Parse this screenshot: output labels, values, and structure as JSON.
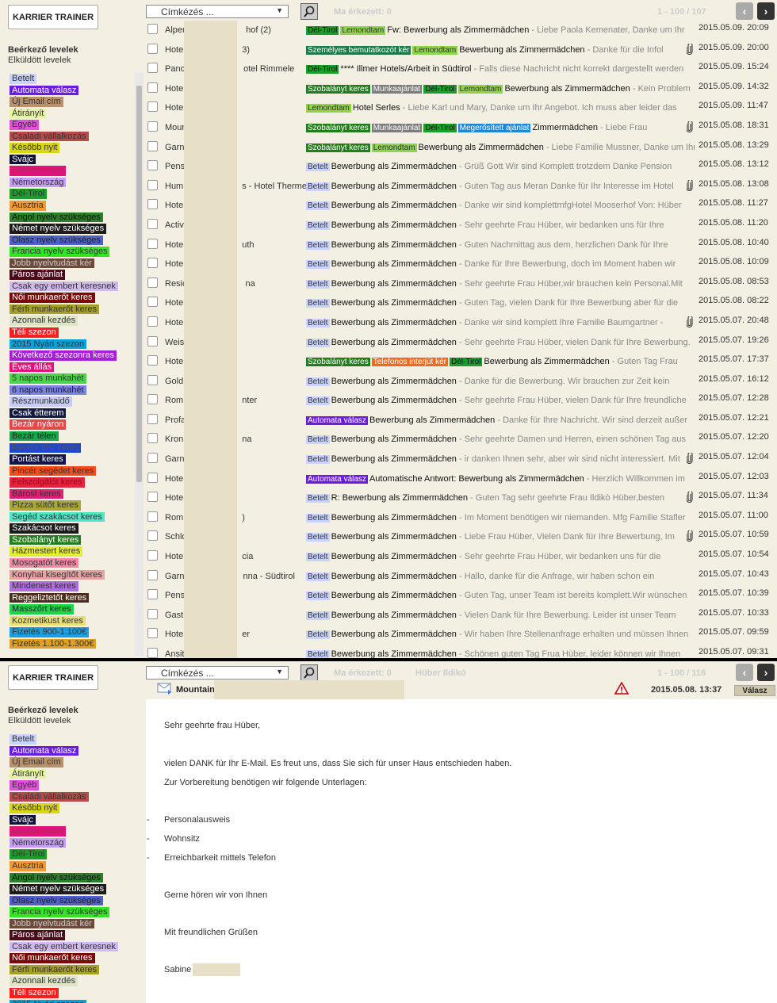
{
  "app": {
    "logo_label": "KARRIER TRAINER"
  },
  "sidebar": {
    "inbox_label": "Beérkező levelek",
    "sent_label": "Elküldött levelek",
    "labels": [
      {
        "text": "Betelt",
        "bg": "#c9d3ff",
        "fg": "#333"
      },
      {
        "text": "Automata válasz",
        "bg": "#6a1de0",
        "fg": "#fff"
      },
      {
        "text": "Új Email cím",
        "bg": "#b9916a",
        "fg": "#333"
      },
      {
        "text": "Átirányít",
        "bg": "#e6f3a3",
        "fg": "#333"
      },
      {
        "text": "Egyéb",
        "bg": "#e252d8",
        "fg": "#333"
      },
      {
        "text": "Családi vállalkozás",
        "bg": "#b64b4b",
        "fg": "#333"
      },
      {
        "text": "Később nyit",
        "bg": "#d9d614",
        "fg": "#333"
      },
      {
        "text": "Svájc",
        "bg": "#121236",
        "fg": "#fff"
      },
      {
        "text": "Liechtenstein",
        "bg": "#e0137a",
        "fg": "#b42a58"
      },
      {
        "text": "Németország",
        "bg": "#c79ef5",
        "fg": "#333"
      },
      {
        "text": "Dél-Tirol",
        "bg": "#1b9f2a",
        "fg": "#333"
      },
      {
        "text": "Ausztria",
        "bg": "#f29a34",
        "fg": "#333"
      },
      {
        "text": "Angol nyelv szükséges",
        "bg": "#2c7f2a",
        "fg": "#111"
      },
      {
        "text": "Német nyelv szükséges",
        "bg": "#1c1c1c",
        "fg": "#fff"
      },
      {
        "text": "Olasz nyelv szükséges",
        "bg": "#4f61c9",
        "fg": "#222"
      },
      {
        "text": "Francia nyelv szükséges",
        "bg": "#31e624",
        "fg": "#333"
      },
      {
        "text": "Jobb nyelvtudást kér",
        "bg": "#6b4a3a",
        "fg": "#ccc"
      },
      {
        "text": "Páros ajánlat",
        "bg": "#4a0b1a",
        "fg": "#fff"
      },
      {
        "text": "Csak egy embert keresnek",
        "bg": "#d0b9ee",
        "fg": "#333"
      },
      {
        "text": "Női munkaerőt keres",
        "bg": "#7a0a0a",
        "fg": "#fff"
      },
      {
        "text": "Férfi munkaerőt keres",
        "bg": "#a6a02a",
        "fg": "#333"
      },
      {
        "text": "Azonnali kezdés",
        "bg": "#dfe5c7",
        "fg": "#333"
      },
      {
        "text": "Téli szezon",
        "bg": "#f41f1f",
        "fg": "#fff"
      },
      {
        "text": "2015 Nyári szezon",
        "bg": "#0aa3d9",
        "fg": "#234"
      },
      {
        "text": "Következő szezonra keres",
        "bg": "#a61fd6",
        "fg": "#fff"
      },
      {
        "text": "Éves állás",
        "bg": "#e5117a",
        "fg": "#fff"
      },
      {
        "text": "5 napos munkahét",
        "bg": "#4fd34f",
        "fg": "#333"
      },
      {
        "text": "6 napos munkahét",
        "bg": "#7a82e2",
        "fg": "#222"
      },
      {
        "text": "Részmunkaidő",
        "bg": "#c7ccf4",
        "fg": "#333"
      },
      {
        "text": "Csak étterem",
        "bg": "#111b3d",
        "fg": "#fff"
      },
      {
        "text": "Bezár nyáron",
        "bg": "#e0494a",
        "fg": "#fff"
      },
      {
        "text": "Bezár télen",
        "bg": "#17a84a",
        "fg": "#222"
      },
      {
        "text": "Recepcióst keres",
        "bg": "#1e46d0",
        "fg": "#555"
      },
      {
        "text": "Portást keres",
        "bg": "#141449",
        "fg": "#fff"
      },
      {
        "text": "Pincér segédet keres",
        "bg": "#f74d1a",
        "fg": "#333"
      },
      {
        "text": "Felszolgálót keres",
        "bg": "#e0263d",
        "fg": "#a02"
      },
      {
        "text": "Bárost keres",
        "bg": "#e31f75",
        "fg": "#333"
      },
      {
        "text": "Pizza sütőt keres",
        "bg": "#a7a73a",
        "fg": "#333"
      },
      {
        "text": "Segéd szakácsot keres",
        "bg": "#4fe6c6",
        "fg": "#333"
      },
      {
        "text": "Szakácsot keres",
        "bg": "#1b1b1b",
        "fg": "#fff"
      },
      {
        "text": "Szobalányt keres",
        "bg": "#237d1d",
        "fg": "#fff"
      },
      {
        "text": "Házmestert keres",
        "bg": "#e3ee33",
        "fg": "#333"
      },
      {
        "text": "Mosogatót keres",
        "bg": "#f28aa7",
        "fg": "#333"
      },
      {
        "text": "Konyhai kisegítőt keres",
        "bg": "#e7a3a3",
        "fg": "#333"
      },
      {
        "text": "Mindenest keres",
        "bg": "#b06de0",
        "fg": "#333"
      },
      {
        "text": "Reggeliztetőt keres",
        "bg": "#4b2c1f",
        "fg": "#fff"
      },
      {
        "text": "Masszőrt keres",
        "bg": "#1fd34a",
        "fg": "#222"
      },
      {
        "text": "Kozmetikust keres",
        "bg": "#e6e079",
        "fg": "#333"
      },
      {
        "text": "Fizetés 900-1.100€",
        "bg": "#1aa0e0",
        "fg": "#333"
      },
      {
        "text": "Fizetés 1.100-1.300€",
        "bg": "#e0a020",
        "fg": "#333"
      }
    ]
  },
  "toolbar": {
    "tag_select": "Címkézés ...",
    "today_label": "Ma érkezett: 0",
    "range_top": "1 - 100 / 107",
    "range_bottom": "1 - 100 / 116",
    "viewer_name": "Hüber Ildikó"
  },
  "emails": [
    {
      "sender": "Alpen",
      "sender2": "hof (2)",
      "tags": [
        [
          "Dél-Tirol",
          "#1b9f2a",
          "#111"
        ],
        [
          "Lemondtam",
          "#8ed44d",
          "#333"
        ]
      ],
      "subject": "Fw: Bewerbung als Zimmermädchen",
      "preview": " - Liebe Paola Kemenater, Danke um Ihr",
      "clip": false,
      "date": "2015.05.09. 20:09"
    },
    {
      "sender": "Hote",
      "sender2": "3)",
      "tags": [
        [
          "Személyes bemutatkozót kér",
          "#1c7a4a",
          "#fff"
        ],
        [
          "Lemondtam",
          "#8ed44d",
          "#333"
        ]
      ],
      "subject": "Bewerbung als Zimmermädchen",
      "preview": " - Danke für die Infol",
      "clip": true,
      "date": "2015.05.09. 20:00"
    },
    {
      "sender": "Panc",
      "sender2": "otel Rimmele",
      "tags": [
        [
          "Dél-Tirol",
          "#1b9f2a",
          "#111"
        ]
      ],
      "subject": "**** Illmer Hotels/Arbeit in Südtirol",
      "preview": " - Falls diese Nachricht nicht korrekt dargestellt werden",
      "clip": false,
      "date": "2015.05.09. 15:24"
    },
    {
      "sender": "Hote",
      "sender2": "",
      "tags": [
        [
          "Szobalányt keres",
          "#237d1d",
          "#fff"
        ],
        [
          "Munkaajánlat",
          "#7d7d7d",
          "#fff"
        ],
        [
          "Dél-Tirol",
          "#1b9f2a",
          "#111"
        ],
        [
          "Lemondtam",
          "#8ed44d",
          "#333"
        ]
      ],
      "subject": "Bewerbung als Zimmermädchen",
      "preview": " - Kein Problem",
      "clip": false,
      "date": "2015.05.09. 14:32"
    },
    {
      "sender": "Hote",
      "sender2": "",
      "tags": [
        [
          "Lemondtam",
          "#8ed44d",
          "#333"
        ]
      ],
      "subject": "Hotel Serles",
      "preview": " - Liebe Karl und Mary, Danke um Ihr Angebot. Ich muss aber leider das",
      "clip": false,
      "date": "2015.05.09. 11:47"
    },
    {
      "sender": "Moun",
      "sender2": "",
      "tags": [
        [
          "Szobalányt keres",
          "#237d1d",
          "#fff"
        ],
        [
          "Munkaajánlat",
          "#7d7d7d",
          "#fff"
        ],
        [
          "Dél-Tirol",
          "#1b9f2a",
          "#111"
        ],
        [
          "Megerősített ajánlat",
          "#1e88d8",
          "#fff"
        ]
      ],
      "subject": "Zimmermädchen",
      "preview": " - Liebe Frau",
      "clip": true,
      "date": "2015.05.08. 18:31"
    },
    {
      "sender": "Garn",
      "sender2": "",
      "tags": [
        [
          "Szobalányt keres",
          "#237d1d",
          "#fff"
        ],
        [
          "Lemondtam",
          "#8ed44d",
          "#333"
        ]
      ],
      "subject": "Bewerbung als Zimmermädchen",
      "preview": " - Liebe Familie Mussner, Danke um Ihr",
      "clip": false,
      "date": "2015.05.08. 13:29"
    },
    {
      "sender": "Pens",
      "sender2": "",
      "tags": [
        [
          "Betelt",
          "#c9d3ff",
          "#333"
        ]
      ],
      "subject": "Bewerbung als Zimmermädchen",
      "preview": " - Grüß Gott Wir sind Komplett trotzdem Danke Pension",
      "clip": false,
      "date": "2015.05.08. 13:12"
    },
    {
      "sender": "Hum",
      "sender2": "s - Hotel Therme",
      "tags": [
        [
          "Betelt",
          "#c9d3ff",
          "#333"
        ]
      ],
      "subject": "Bewerbung als Zimmermädchen",
      "preview": " - Guten Tag aus Meran Danke für Ihr Interesse im Hotel",
      "clip": true,
      "date": "2015.05.08. 13:08"
    },
    {
      "sender": "Hote",
      "sender2": "",
      "tags": [
        [
          "Betelt",
          "#c9d3ff",
          "#333"
        ]
      ],
      "subject": "Bewerbung als Zimmermädchen",
      "preview": " - Danke wir sind komplettmfgHotel Mooserhof Von: Hüber",
      "clip": false,
      "date": "2015.05.08. 11:27"
    },
    {
      "sender": "Activ",
      "sender2": "",
      "tags": [
        [
          "Betelt",
          "#c9d3ff",
          "#333"
        ]
      ],
      "subject": "Bewerbung als Zimmermädchen",
      "preview": " - Sehr geehrte Frau Hüber, wir bedanken uns für Ihre",
      "clip": false,
      "date": "2015.05.08. 11:20"
    },
    {
      "sender": "Hote",
      "sender2": "uth",
      "tags": [
        [
          "Betelt",
          "#c9d3ff",
          "#333"
        ]
      ],
      "subject": "Bewerbung als Zimmermädchen",
      "preview": " - Guten Nachmittag aus dem, herzlichen Dank für Ihre",
      "clip": false,
      "date": "2015.05.08. 10:40"
    },
    {
      "sender": "Hote",
      "sender2": "",
      "tags": [
        [
          "Betelt",
          "#c9d3ff",
          "#333"
        ]
      ],
      "subject": "Bewerbung als Zimmermädchen",
      "preview": " - Danke für Ihre Bewerbung, doch im Moment haben wir",
      "clip": false,
      "date": "2015.05.08. 10:09"
    },
    {
      "sender": "Resic",
      "sender2": "na",
      "tags": [
        [
          "Betelt",
          "#c9d3ff",
          "#333"
        ]
      ],
      "subject": "Bewerbung als Zimmermädchen",
      "preview": " - Sehr geehrte Frau Hüber,wir brauchen kein Personal.Mit",
      "clip": false,
      "date": "2015.05.08. 08:53"
    },
    {
      "sender": "Hote",
      "sender2": "",
      "tags": [
        [
          "Betelt",
          "#c9d3ff",
          "#333"
        ]
      ],
      "subject": "Bewerbung als Zimmermädchen",
      "preview": " - Guten Tag, vielen Dank für Ihre Bewerbung aber für die",
      "clip": false,
      "date": "2015.05.08. 08:22"
    },
    {
      "sender": "Hote",
      "sender2": "",
      "tags": [
        [
          "Betelt",
          "#c9d3ff",
          "#333"
        ]
      ],
      "subject": "Bewerbung als Zimmermädchen",
      "preview": " - Danke wir sind komplett Ihre Familie Baumgartner -",
      "clip": true,
      "date": "2015.05.07. 20:48"
    },
    {
      "sender": "Weis",
      "sender2": "",
      "tags": [
        [
          "Betelt",
          "#c9d3ff",
          "#333"
        ]
      ],
      "subject": "Bewerbung als Zimmermädchen",
      "preview": " - Sehr geehrte Frau Hüber, vielen Dank für Ihre Bewerbung.",
      "clip": false,
      "date": "2015.05.07. 19:26"
    },
    {
      "sender": "Hote",
      "sender2": "",
      "tags": [
        [
          "Szobalányt keres",
          "#237d1d",
          "#fff"
        ],
        [
          "Telefonos interjút kér",
          "#f06a22",
          "#fff"
        ],
        [
          "Dél-Tirol",
          "#1b9f2a",
          "#111"
        ]
      ],
      "subject": "Bewerbung als Zimmermädchen",
      "preview": " - Guten Tag Frau",
      "clip": false,
      "date": "2015.05.07. 17:37"
    },
    {
      "sender": "Gold",
      "sender2": "",
      "tags": [
        [
          "Betelt",
          "#c9d3ff",
          "#333"
        ]
      ],
      "subject": "Bewerbung als Zimmermädchen",
      "preview": " - Danke für die Bewerbung. Wir brauchen zur Zeit kein",
      "clip": false,
      "date": "2015.05.07. 16:12"
    },
    {
      "sender": "Rom",
      "sender2": "nter",
      "tags": [
        [
          "Betelt",
          "#c9d3ff",
          "#333"
        ]
      ],
      "subject": "Bewerbung als Zimmermädchen",
      "preview": " - Sehr geehrte Frau Hüber, vielen Dank für Ihre freundliche",
      "clip": false,
      "date": "2015.05.07. 12:28"
    },
    {
      "sender": "Profa",
      "sender2": "",
      "tags": [
        [
          "Automata válasz",
          "#6a1de0",
          "#fff"
        ]
      ],
      "subject": "Bewerbung als Zimmermädchen",
      "preview": " - Danke für Ihre Nachricht. Wir sind derzeit außer",
      "clip": false,
      "date": "2015.05.07. 12:21"
    },
    {
      "sender": "Kron",
      "sender2": "na",
      "tags": [
        [
          "Betelt",
          "#c9d3ff",
          "#333"
        ]
      ],
      "subject": "Bewerbung als Zimmermädchen",
      "preview": " - Sehr geehrte Damen und  Herren, einen schönen Tag aus",
      "clip": false,
      "date": "2015.05.07. 12:20"
    },
    {
      "sender": "Garn",
      "sender2": "",
      "tags": [
        [
          "Betelt",
          "#c9d3ff",
          "#333"
        ]
      ],
      "subject": "Bewerbung als Zimmermädchen",
      "preview": " - ir danken Ihnen sehr, aber wir sind nicht interessiert. Mit",
      "clip": true,
      "date": "2015.05.07. 12:04"
    },
    {
      "sender": "Hote",
      "sender2": "",
      "tags": [
        [
          "Automata válasz",
          "#6a1de0",
          "#fff"
        ]
      ],
      "subject": "Automatische Antwort: Bewerbung als Zimmermädchen",
      "preview": " - Herzlich Willkommen im",
      "clip": false,
      "date": "2015.05.07. 12:03"
    },
    {
      "sender": "Hote",
      "sender2": "",
      "tags": [
        [
          "Betelt",
          "#c9d3ff",
          "#333"
        ]
      ],
      "subject": "R: Bewerbung als Zimmermädchen",
      "preview": " - Guten Tag sehr geehrte Frau Ildikò Hüber,besten",
      "clip": true,
      "date": "2015.05.07. 11:34"
    },
    {
      "sender": "Rom",
      "sender2": ")",
      "tags": [
        [
          "Betelt",
          "#c9d3ff",
          "#333"
        ]
      ],
      "subject": "Bewerbung als Zimmermädchen",
      "preview": " - Im Moment benötigen wir niemanden. Mfg Familie Stafler",
      "clip": false,
      "date": "2015.05.07. 11:00"
    },
    {
      "sender": "Schlo",
      "sender2": "",
      "tags": [
        [
          "Betelt",
          "#c9d3ff",
          "#333"
        ]
      ],
      "subject": "Bewerbung als Zimmermädchen",
      "preview": " - Liebe Frau Hüber, Vielen Dank für Ihre Bewerbung, Im",
      "clip": true,
      "date": "2015.05.07. 10:59"
    },
    {
      "sender": "Hote",
      "sender2": "cia",
      "tags": [
        [
          "Betelt",
          "#c9d3ff",
          "#333"
        ]
      ],
      "subject": "Bewerbung als Zimmermädchen",
      "preview": " - Sehr geehrte Frau Hüber, wir bedanken uns für die",
      "clip": false,
      "date": "2015.05.07. 10:54"
    },
    {
      "sender": "Garn",
      "sender2": "nna - Südtirol",
      "tags": [
        [
          "Betelt",
          "#c9d3ff",
          "#333"
        ]
      ],
      "subject": "Bewerbung als Zimmermädchen",
      "preview": " - Hallo, danke für die Anfrage, wir haben schon ein",
      "clip": false,
      "date": "2015.05.07. 10:43"
    },
    {
      "sender": "Pens",
      "sender2": "",
      "tags": [
        [
          "Betelt",
          "#c9d3ff",
          "#333"
        ]
      ],
      "subject": "Bewerbung als Zimmermädchen",
      "preview": " - Guten Tag, unser Team ist bereits komplett.Wir wünschen",
      "clip": false,
      "date": "2015.05.07. 10:39"
    },
    {
      "sender": "Gastl",
      "sender2": "",
      "tags": [
        [
          "Betelt",
          "#c9d3ff",
          "#333"
        ]
      ],
      "subject": "Bewerbung als Zimmermädchen",
      "preview": " - Vielen Dank für Ihre Bewerbung. Leider ist unser Team",
      "clip": false,
      "date": "2015.05.07. 10:33"
    },
    {
      "sender": "Hote",
      "sender2": "er",
      "tags": [
        [
          "Betelt",
          "#c9d3ff",
          "#333"
        ]
      ],
      "subject": "Bewerbung als Zimmermädchen",
      "preview": " - Wir haben Ihre Stellenanfrage erhalten und müssen Ihnen",
      "clip": false,
      "date": "2015.05.07. 09:59"
    },
    {
      "sender": "Ansit",
      "sender2": "",
      "tags": [
        [
          "Betelt",
          "#c9d3ff",
          "#333"
        ]
      ],
      "subject": "Bewerbung als Zimmermädchen",
      "preview": " - Schönen guten Tag Frua Hüber, leider können wir Ihnen",
      "clip": false,
      "date": "2015.05.07. 09:31"
    }
  ],
  "message": {
    "sender": "Mountain",
    "date": "2015.05.08. 13:37",
    "reply_label": "Válasz",
    "greeting": "Sehr geehrte frau Hüber,",
    "p1": "vielen DANK für Ihr E-Mail. Es freut uns, dass Sie sich für unser Haus entschieden haben.",
    "p2": "Zur Vorbereitung benötigen wir folgende Unterlagen:",
    "bullet_mark": "-",
    "items": [
      "Personalausweis",
      "Wohnsitz",
      "Erreichbarkeit mittels Telefon"
    ],
    "closing1": "Gerne hören wir von Ihnen",
    "closing2": "Mit freundlichen Grüßen",
    "signature": "Sabine"
  }
}
